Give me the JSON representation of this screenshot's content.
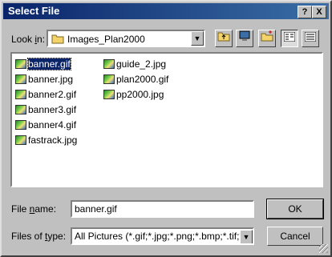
{
  "window": {
    "title": "Select File"
  },
  "title_buttons": {
    "help": "?",
    "close": "X"
  },
  "lookin": {
    "label_pre": "Look ",
    "label_ul": "i",
    "label_post": "n:",
    "folder": "Images_Plan2000",
    "folder_icon": "folder-icon"
  },
  "toolbar": {
    "up_icon": "up-one-level-icon",
    "desktop_icon": "desktop-icon",
    "new_folder_icon": "new-folder-icon",
    "list_view_icon": "list-view-icon",
    "details_view_icon": "details-view-icon"
  },
  "files": {
    "column1": [
      "banner.gif",
      "banner.jpg",
      "banner2.gif",
      "banner3.gif",
      "banner4.gif",
      "fastrack.jpg"
    ],
    "column2": [
      "guide_2.jpg",
      "plan2000.gif",
      "pp2000.jpg"
    ],
    "selected": "banner.gif"
  },
  "filename": {
    "label_pre": "File ",
    "label_ul": "n",
    "label_post": "ame:",
    "value": "banner.gif"
  },
  "filetype": {
    "label_pre": "Files of ",
    "label_ul": "t",
    "label_post": "ype:",
    "value": "All Pictures (*.gif;*.jpg;*.png;*.bmp;*.tif;*.wmf;*"
  },
  "buttons": {
    "ok": "OK",
    "cancel": "Cancel"
  }
}
